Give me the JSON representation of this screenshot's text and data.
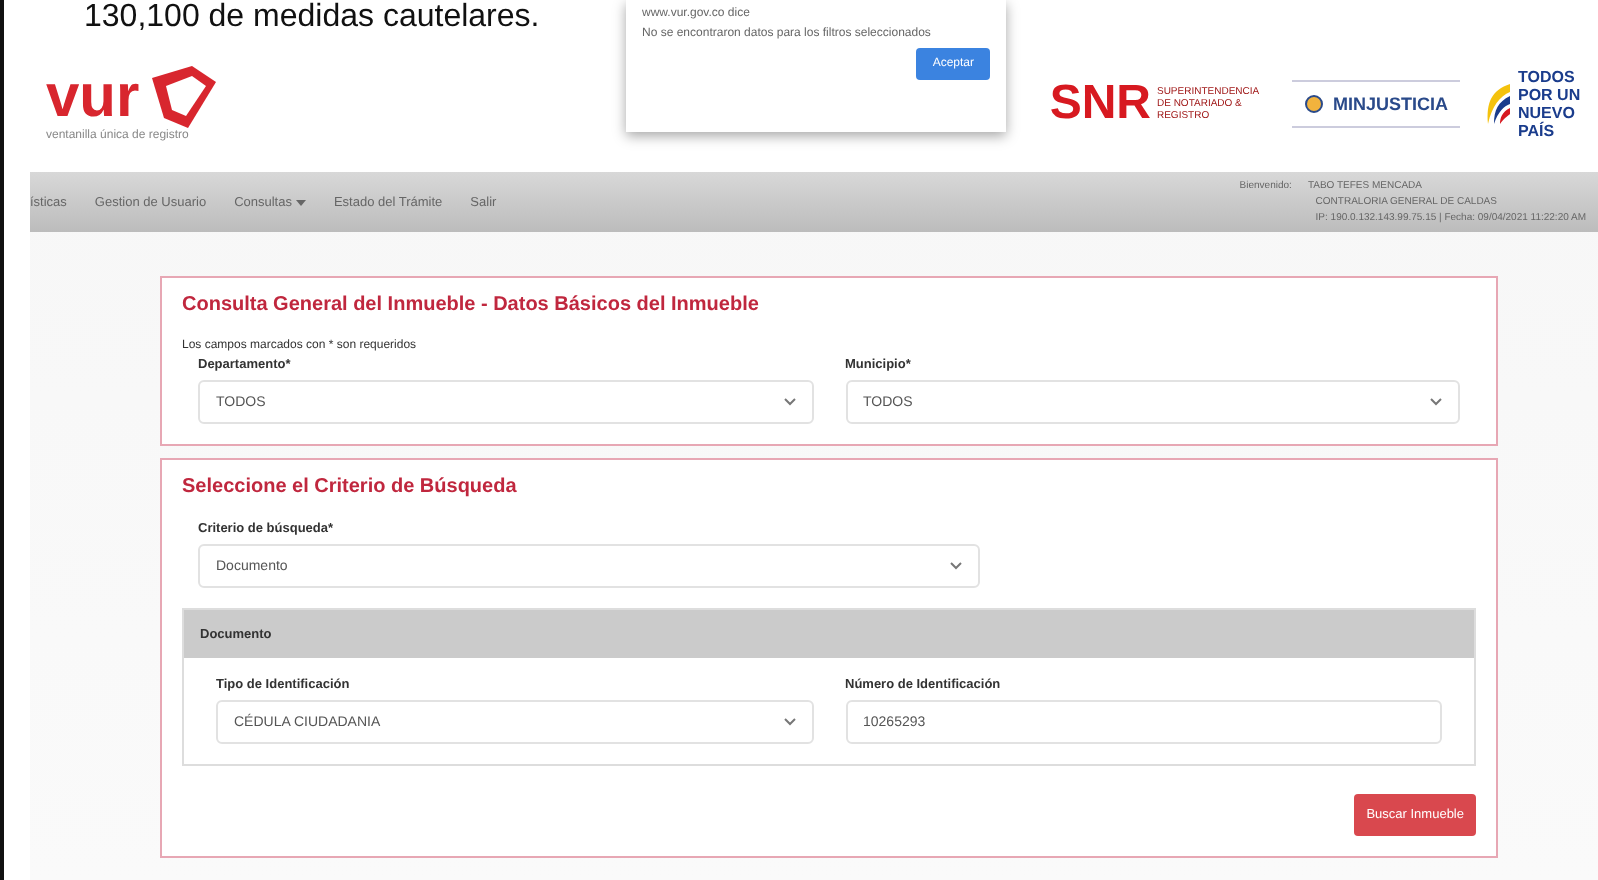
{
  "document_caption": "130,100 de medidas cautelares.",
  "header": {
    "logo_text": "vur",
    "logo_tagline": "ventanilla única de registro",
    "partner_logos": [
      {
        "kind": "snr",
        "text": "SNR",
        "subtext": "SUPERINTENDENCIA DE NOTARIADO & REGISTRO"
      },
      {
        "kind": "ministry",
        "text": "MINJUSTICIA"
      },
      {
        "kind": "government",
        "text": "TODOS POR UN NUEVO PAÍS"
      }
    ]
  },
  "dialog": {
    "title": "www.vur.gov.co dice",
    "message": "No se encontraron datos para los filtros seleccionados",
    "button": "Aceptar"
  },
  "nav": {
    "items": [
      {
        "label": "ísticas",
        "dropdown": false
      },
      {
        "label": "Gestion de Usuario",
        "dropdown": false
      },
      {
        "label": "Consultas",
        "dropdown": true
      },
      {
        "label": "Estado del Trámite",
        "dropdown": false
      },
      {
        "label": "Salir",
        "dropdown": false
      }
    ],
    "user_label": "Bienvenido:",
    "user_name": "TABO TEFES MENCADA",
    "entity": "CONTRALORIA GENERAL DE CALDAS",
    "session": "IP: 190.0.132.143.99.75.15 | Fecha: 09/04/2021 11:22:20 AM"
  },
  "basic_data": {
    "title": "Consulta General del Inmueble - Datos Básicos del Inmueble",
    "note": "Los campos marcados con * son requeridos",
    "fields": [
      {
        "label": "Departamento*",
        "value": "TODOS"
      },
      {
        "label": "Municipio*",
        "value": "TODOS"
      }
    ]
  },
  "criteria": {
    "title": "Seleccione el Criterio de Búsqueda",
    "field": {
      "label": "Criterio de búsqueda*",
      "value": "Documento"
    },
    "panel_title": "Documento",
    "fields": [
      {
        "kind": "select",
        "label": "Tipo de Identificación",
        "value": "CÉDULA CIUDADANIA"
      },
      {
        "kind": "text",
        "label": "Número de Identificación",
        "value": "10265293"
      }
    ],
    "button": "Buscar Inmueble"
  }
}
